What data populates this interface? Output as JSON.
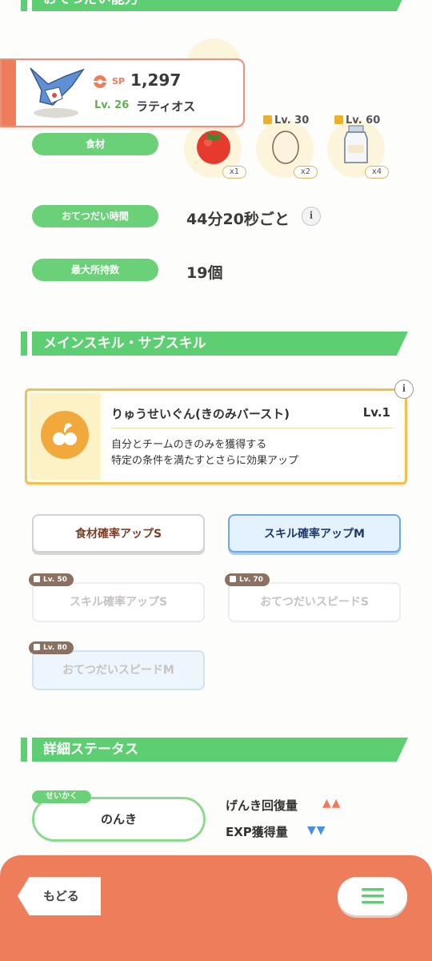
{
  "top_section": {
    "title": "おてつだい能力"
  },
  "pokemon_card": {
    "sp_label": "SP",
    "sp_value": "1,297",
    "level": "Lv. 26",
    "name": "ラティオス"
  },
  "ingredients": {
    "label": "食材",
    "items": [
      {
        "icon": "tomato-icon",
        "quantity": "x1",
        "lock_level": ""
      },
      {
        "icon": "egg-icon",
        "quantity": "x2",
        "lock_level": "Lv. 30"
      },
      {
        "icon": "milk-icon",
        "quantity": "x4",
        "lock_level": "Lv. 60"
      }
    ]
  },
  "help_time": {
    "label": "おてつだい時間",
    "value": "44分20秒ごと"
  },
  "max_carry": {
    "label": "最大所持数",
    "value": "19個"
  },
  "skills_section": {
    "title": "メインスキル・サブスキル"
  },
  "main_skill": {
    "name": "りゅうせいぐん(きのみバースト)",
    "level": "Lv.1",
    "description_line1": "自分とチームのきのみを獲得する",
    "description_line2": "特定の条件を満たすとさらに効果アップ"
  },
  "sub_skills": [
    {
      "label": "食材確率アップS",
      "lock_level": ""
    },
    {
      "label": "スキル確率アップM",
      "lock_level": ""
    },
    {
      "label": "スキル確率アップS",
      "lock_level": "Lv. 50"
    },
    {
      "label": "おてつだいスピードS",
      "lock_level": "Lv. 70"
    },
    {
      "label": "おてつだいスピードM",
      "lock_level": "Lv. 80"
    }
  ],
  "details_section": {
    "title": "詳細ステータス"
  },
  "nature": {
    "tag": "せいかく",
    "value": "のんき",
    "up_label": "げんき回復量",
    "up_marks": "▲▲",
    "down_label": "EXP獲得量",
    "down_marks": "▼▼"
  },
  "footer": {
    "back_label": "もどる"
  },
  "colors": {
    "accent_green": "#5dcf72",
    "footer_orange": "#ee7d5c",
    "main_skill_border": "#e9c450",
    "up_color": "#f07a5a",
    "down_color": "#4a90e2"
  }
}
